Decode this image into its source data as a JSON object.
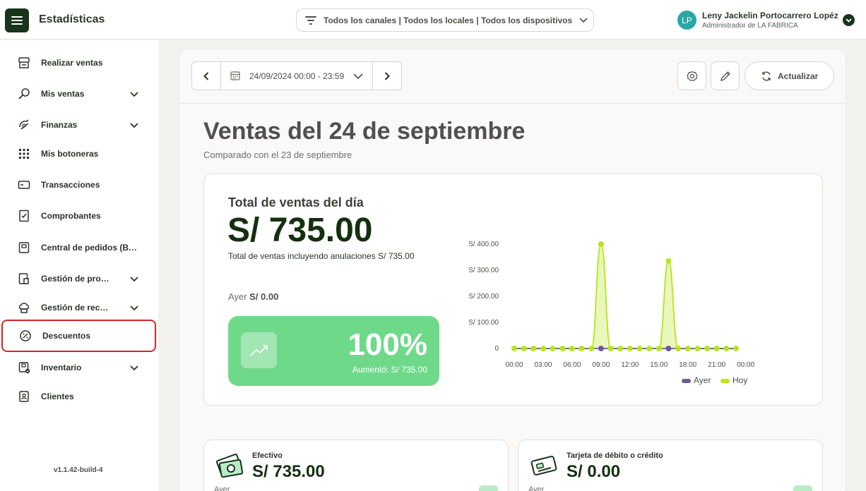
{
  "header": {
    "app_title": "Estadísticas",
    "filter_text": "Todos los canales | Todos los locales | Todos los dispositivos",
    "user_initials": "LP",
    "user_name": "Leny Jackelin Portocarrero Lopéz",
    "user_role": "Administrador de LA FABRICA"
  },
  "sidebar": {
    "items": [
      {
        "label": "Realizar ventas",
        "icon": "register-icon",
        "expandable": false
      },
      {
        "label": "Mis ventas",
        "icon": "search-sales-icon",
        "expandable": true
      },
      {
        "label": "Finanzas",
        "icon": "finance-icon",
        "expandable": true
      },
      {
        "label": "Mis botoneras",
        "icon": "grid-icon",
        "expandable": false
      },
      {
        "label": "Transacciones",
        "icon": "card-icon",
        "expandable": false
      },
      {
        "label": "Comprobantes",
        "icon": "receipt-icon",
        "expandable": false
      },
      {
        "label": "Central de pedidos (B…",
        "icon": "orders-icon",
        "expandable": false
      },
      {
        "label": "Gestión de pro…",
        "icon": "products-icon",
        "expandable": true
      },
      {
        "label": "Gestión de rec…",
        "icon": "chef-icon",
        "expandable": true
      },
      {
        "label": "Descuentos",
        "icon": "discount-icon",
        "expandable": false,
        "active": true
      },
      {
        "label": "Inventario",
        "icon": "inventory-icon",
        "expandable": true
      },
      {
        "label": "Clientes",
        "icon": "clients-icon",
        "expandable": false
      }
    ],
    "version": "v1.1.42-build-4"
  },
  "toolbar": {
    "date_range": "24/09/2024 00:00 - 23:59",
    "refresh_label": "Actualizar"
  },
  "page": {
    "title": "Ventas del 24 de septiembre",
    "subtitle": "Comparado con el 23 de septiembre"
  },
  "summary": {
    "label": "Total de ventas del día",
    "total": "S/ 735.00",
    "note": "Total de ventas incluyendo anulaciones S/ 735.00",
    "yesterday_prefix": "Ayer",
    "yesterday_value": "S/ 0.00",
    "percent": "100%",
    "increase": "Aumentó: S/ 735.00"
  },
  "payments": [
    {
      "label": "Efectivo",
      "value": "S/ 735.00",
      "yesterday": "Ayer",
      "icon": "cash-icon"
    },
    {
      "label": "Tarjeta de débito o crédito",
      "value": "S/ 0.00",
      "yesterday": "Ayer",
      "icon": "credit-card-icon"
    }
  ],
  "colors": {
    "brand_dark": "#18341a",
    "today": "#b5e61d",
    "yesterday": "#6b5b95",
    "positive": "#6fd98a",
    "active_outline": "#d8232a"
  },
  "chart_data": {
    "type": "area",
    "x": [
      "00:00",
      "01:00",
      "02:00",
      "03:00",
      "04:00",
      "05:00",
      "06:00",
      "07:00",
      "08:00",
      "09:00",
      "10:00",
      "11:00",
      "12:00",
      "13:00",
      "14:00",
      "15:00",
      "16:00",
      "17:00",
      "18:00",
      "19:00",
      "20:00",
      "21:00",
      "22:00",
      "23:00"
    ],
    "x_tick_labels": [
      "00:00",
      "03:00",
      "06:00",
      "09:00",
      "12:00",
      "15:00",
      "18:00",
      "21:00",
      "00:00"
    ],
    "y_tick_labels": [
      "0",
      "S/ 100.00",
      "S/ 200.00",
      "S/ 300.00",
      "S/ 400.00"
    ],
    "ylim": [
      0,
      400
    ],
    "series": [
      {
        "name": "Ayer",
        "color": "#6b5b95",
        "values": [
          0,
          0,
          0,
          0,
          0,
          0,
          0,
          0,
          0,
          0,
          0,
          0,
          0,
          0,
          0,
          0,
          0,
          0,
          0,
          0,
          0,
          0,
          0,
          0
        ]
      },
      {
        "name": "Hoy",
        "color": "#b5e61d",
        "values": [
          0,
          0,
          0,
          0,
          0,
          0,
          0,
          0,
          0,
          400,
          0,
          0,
          0,
          0,
          0,
          0,
          335,
          0,
          0,
          0,
          0,
          0,
          0,
          0
        ]
      }
    ],
    "legend_position": "bottom-right",
    "grid": false
  }
}
